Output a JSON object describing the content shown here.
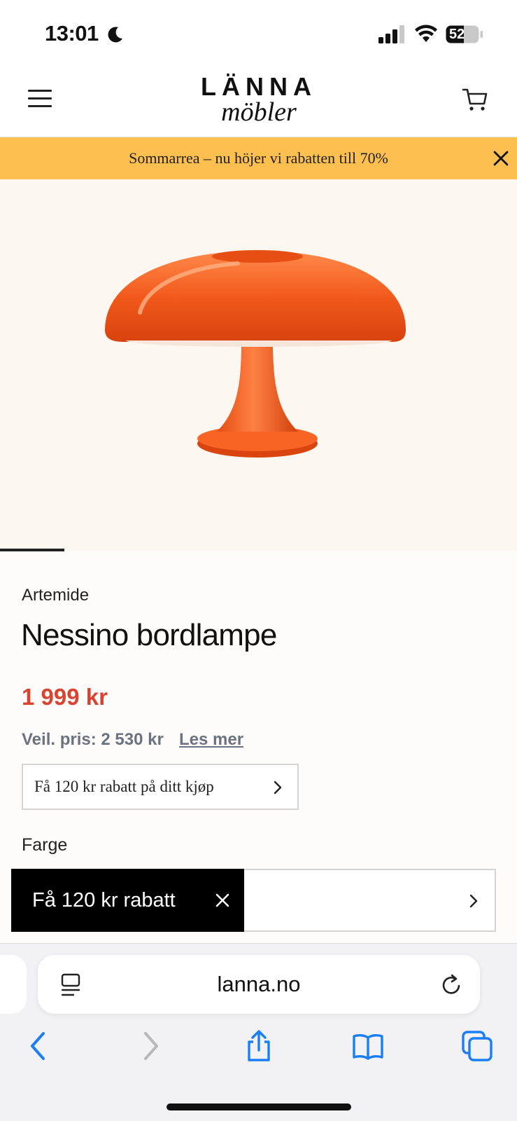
{
  "status_bar": {
    "time": "13:01",
    "battery": "52",
    "icons": [
      "moon-icon",
      "signal-icon",
      "wifi-icon",
      "battery-icon"
    ]
  },
  "header": {
    "logo_top": "LÄNNA",
    "logo_bottom": "möbler",
    "icons": [
      "menu-icon",
      "cart-icon"
    ]
  },
  "promo": {
    "text": "Sommarrea – nu höjer vi rabatten till 70%",
    "close_icon": "close-icon"
  },
  "product": {
    "brand": "Artemide",
    "title": "Nessino bordlampe",
    "price": "1 999 kr",
    "rrp": "Veil. pris: 2 530 kr",
    "read_more": "Les mer",
    "discount_offer": "Få 120 kr rabatt på ditt kjøp",
    "color_label": "Farge",
    "image_subject": "orange-table-lamp",
    "lamp_color": "#f25a1c"
  },
  "discount_pill": {
    "text": "Få 120 kr rabatt"
  },
  "browser": {
    "url": "lanna.no",
    "toolbar": [
      "back-icon",
      "forward-icon",
      "share-icon",
      "bookmarks-icon",
      "tabs-icon"
    ],
    "accent": "#1a7ef5"
  },
  "colors": {
    "promo_bg": "#fdbf50",
    "price": "#d9432f",
    "muted": "#6b7280"
  }
}
